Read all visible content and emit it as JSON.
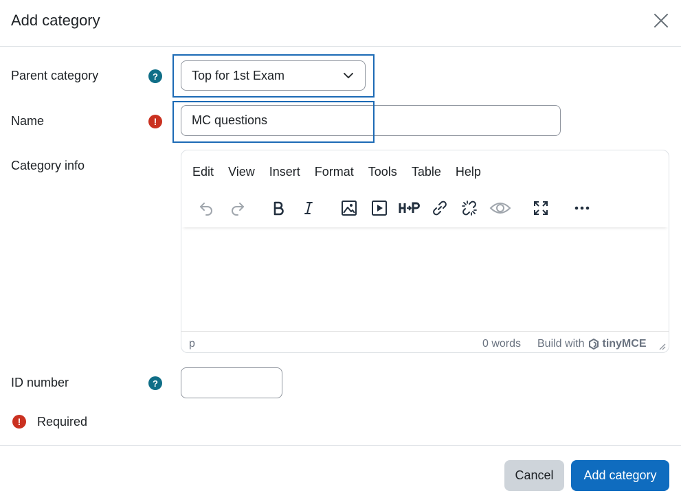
{
  "modal": {
    "title": "Add category"
  },
  "form": {
    "parent": {
      "label": "Parent category",
      "value": "Top for 1st Exam"
    },
    "name": {
      "label": "Name",
      "value": "MC questions"
    },
    "info": {
      "label": "Category info"
    },
    "idnumber": {
      "label": "ID number",
      "value": ""
    },
    "required_note": "Required"
  },
  "editor": {
    "menu": [
      "Edit",
      "View",
      "Insert",
      "Format",
      "Tools",
      "Table",
      "Help"
    ],
    "toolbar": [
      "undo-icon",
      "redo-icon",
      "bold-icon",
      "italic-icon",
      "image-icon",
      "media-icon",
      "h5p-icon",
      "link-icon",
      "unlink-icon",
      "preview-icon",
      "fullscreen-icon",
      "more-icon"
    ],
    "status": {
      "path": "p",
      "words": "0 words",
      "build_with": "Build with",
      "brand": "tinyMCE"
    }
  },
  "buttons": {
    "cancel": "Cancel",
    "submit": "Add category"
  },
  "colors": {
    "primary": "#0f6cbf",
    "help": "#0f6e87",
    "required": "#ca3120",
    "highlight": "#1b6ab5",
    "cancel_bg": "#ced4da"
  }
}
